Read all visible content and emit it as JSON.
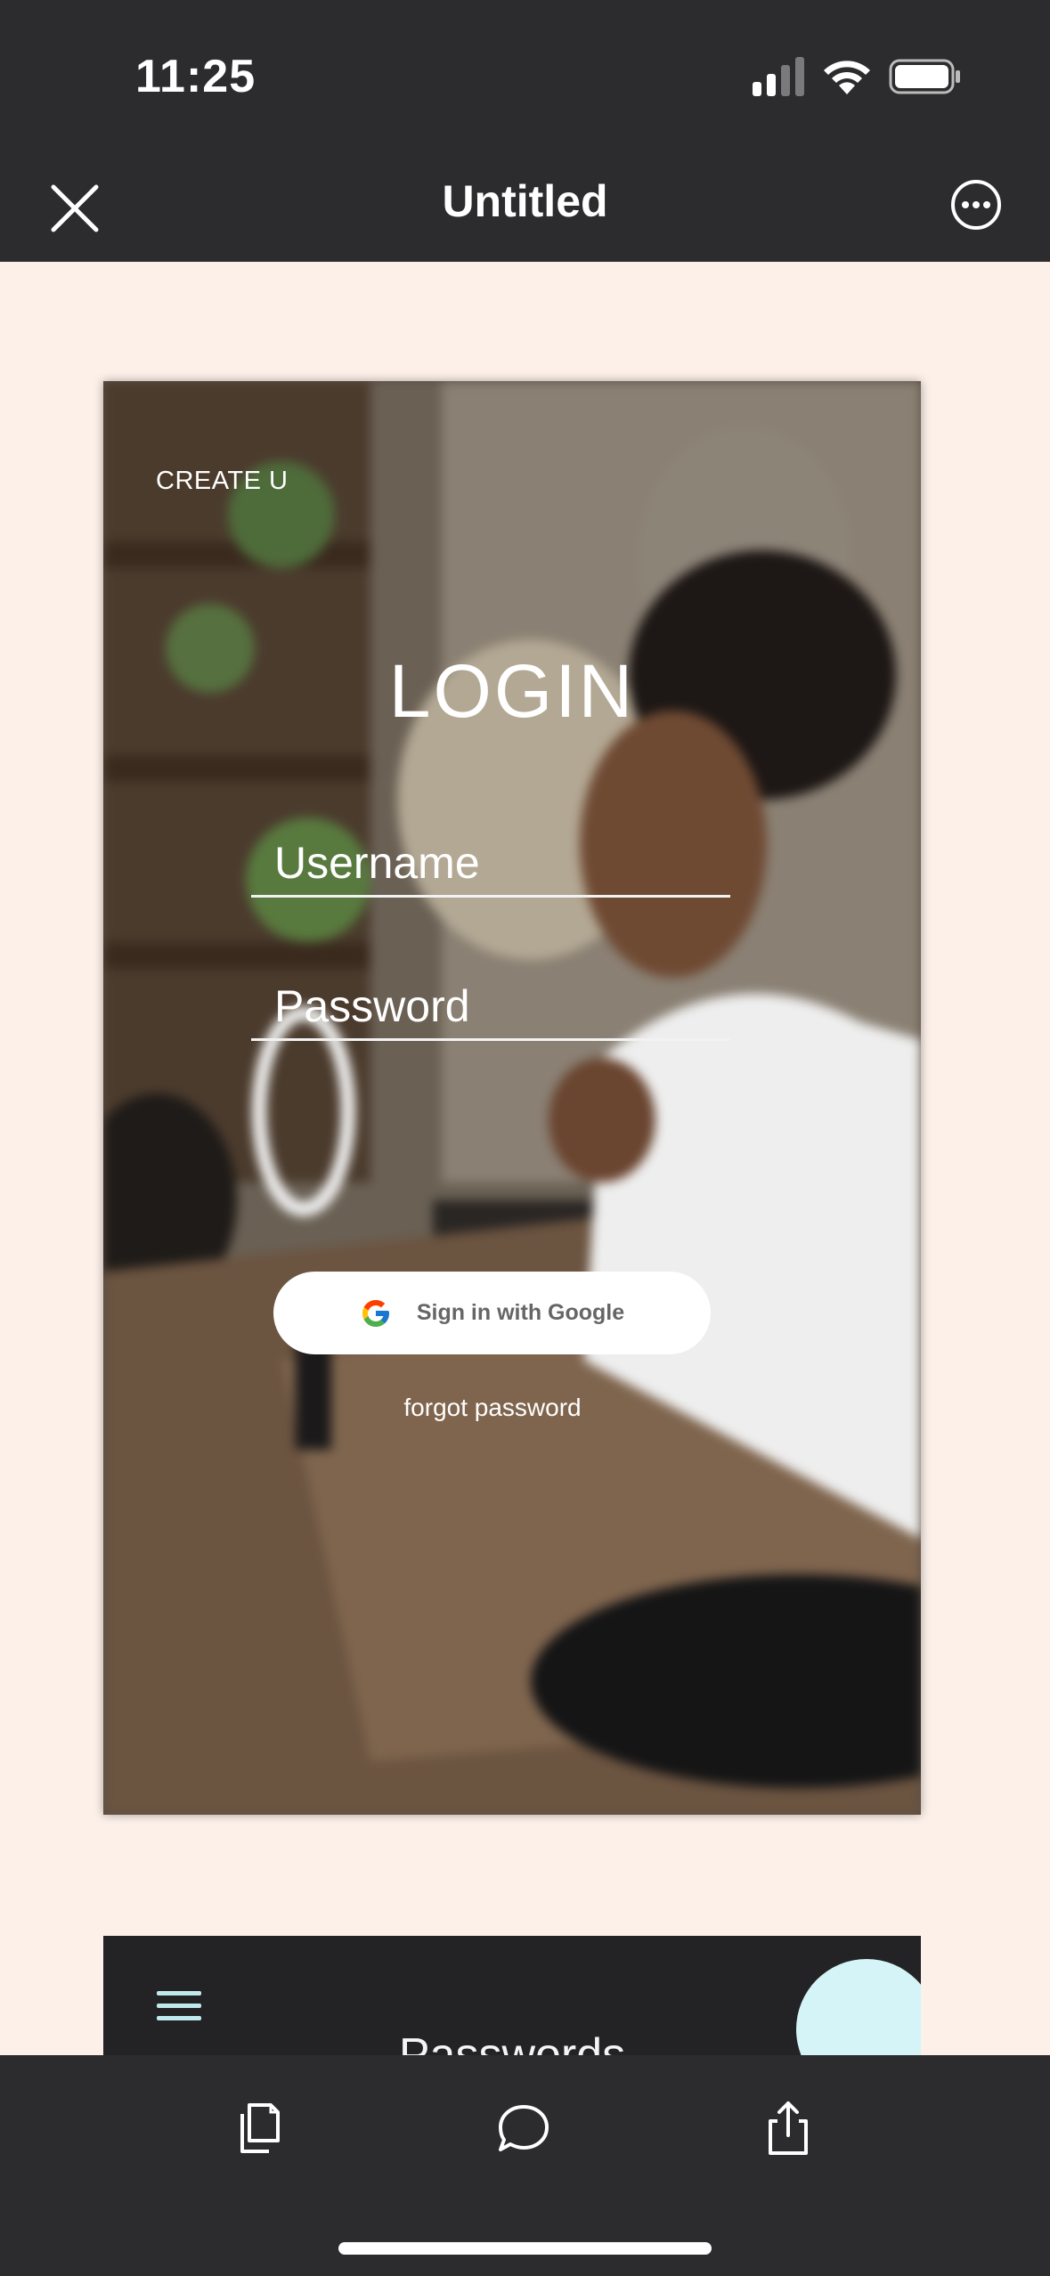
{
  "status_bar": {
    "time": "11:25",
    "icons": [
      "cellular-signal-icon",
      "wifi-icon",
      "battery-icon"
    ]
  },
  "nav": {
    "title": "Untitled",
    "close_icon": "close-icon",
    "more_icon": "more-options-icon"
  },
  "prototype": {
    "create_link": "CREATE U",
    "login_title": "LOGIN",
    "username_placeholder": "Username",
    "password_placeholder": "Password",
    "google_button_label": "Sign in with Google",
    "forgot_password": "forgot password"
  },
  "second_frame": {
    "title": "Passwords"
  },
  "toolbar": {
    "icons": [
      "pages-icon",
      "comment-icon",
      "share-icon"
    ]
  },
  "colors": {
    "chrome": "#2c2c2e",
    "canvas": "#fdf0e9",
    "fab": "#d5f4f7",
    "hamburger": "#bfe9ec"
  }
}
